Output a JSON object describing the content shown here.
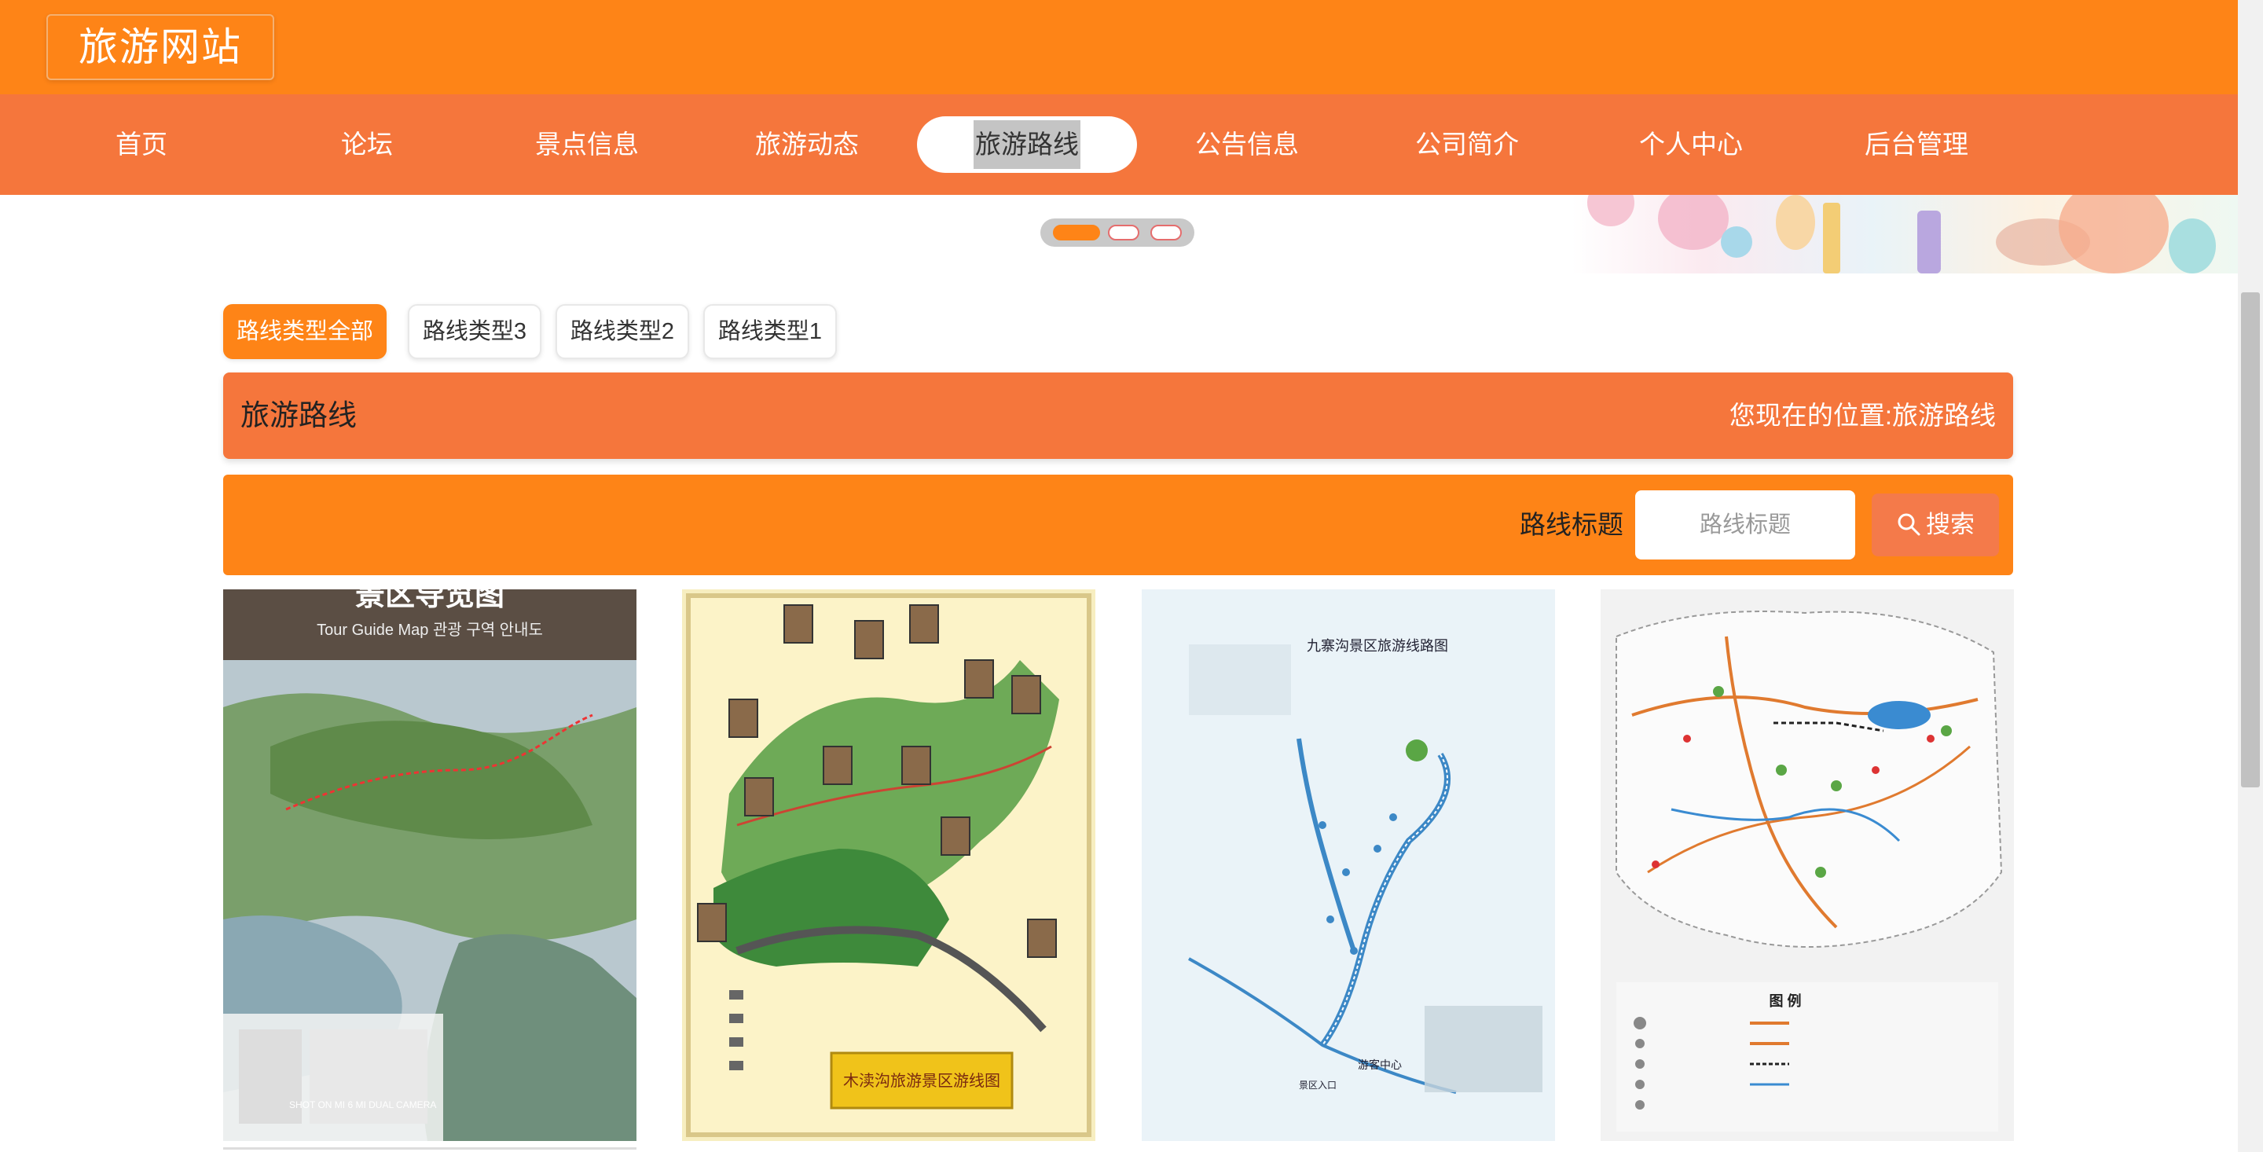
{
  "header": {
    "site_title": "旅游网站"
  },
  "nav": {
    "items": [
      {
        "label": "首页"
      },
      {
        "label": "论坛"
      },
      {
        "label": "景点信息"
      },
      {
        "label": "旅游动态"
      },
      {
        "label": "旅游路线"
      },
      {
        "label": "公告信息"
      },
      {
        "label": "公司简介"
      },
      {
        "label": "个人中心"
      },
      {
        "label": "后台管理"
      }
    ],
    "active_index": 4
  },
  "carousel": {
    "slide_count": 3,
    "active_slide": 1
  },
  "categories": [
    {
      "label": "路线类型全部"
    },
    {
      "label": "路线类型3"
    },
    {
      "label": "路线类型2"
    },
    {
      "label": "路线类型1"
    }
  ],
  "active_category_index": 0,
  "section": {
    "title": "旅游路线",
    "location_prefix": "您现在的位置:",
    "location_current": "旅游路线"
  },
  "search": {
    "label": "路线标题",
    "placeholder": "路线标题",
    "button_label": "搜索"
  },
  "cards": [
    {
      "image_title": "景区导览图",
      "image_subtitle": "Tour Guide Map   관광 구역 안내도",
      "image_caption": "SHOT ON MI 6\nMI DUAL CAMERA"
    },
    {
      "image_title": "木渎沟旅游景区游线图"
    },
    {
      "image_title": "九寨沟景区旅游线路图",
      "image_label_center": "游客中心",
      "image_label_entry": "景区入口"
    },
    {
      "image_title": "图 例"
    }
  ],
  "colors": {
    "header_orange": "#fe8417",
    "nav_orange": "#f5763c",
    "search_button": "#f47a4a"
  }
}
